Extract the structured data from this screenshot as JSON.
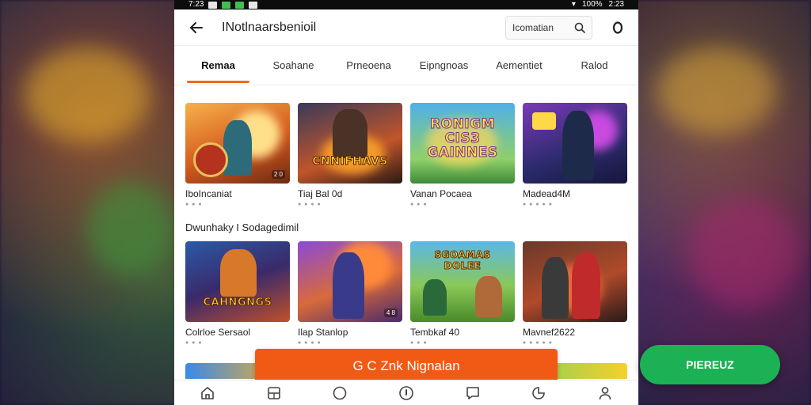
{
  "status": {
    "time": "7:23",
    "battery": "100%",
    "clock": "2:23"
  },
  "appbar": {
    "title": "INotlnaarsbenioil",
    "search_label": "Icomatian"
  },
  "tabs": [
    {
      "label": "Remaa",
      "active": true
    },
    {
      "label": "Soahane",
      "active": false
    },
    {
      "label": "Prneoena",
      "active": false
    },
    {
      "label": "Eipngnoas",
      "active": false
    },
    {
      "label": "Aementiet",
      "active": false
    },
    {
      "label": "Ralod",
      "active": false
    }
  ],
  "row1": [
    {
      "title": "IboIncaniat",
      "logo": "",
      "tag": "2 0"
    },
    {
      "title": "Tiaj Bal 0d",
      "logo": "CNNIFHAVS",
      "tag": ""
    },
    {
      "title": "Vanan Pocaea",
      "logo": "RONIGM CIS3 GAINNES",
      "tag": ""
    },
    {
      "title": "Madead4M",
      "logo": "",
      "tag": ""
    }
  ],
  "section": {
    "title": "Dwunhaky I Sodagedimil"
  },
  "row2": [
    {
      "title": "Colrloe Sersaol",
      "logo": "CAHNGNGS",
      "tag": ""
    },
    {
      "title": "Ilap Stanlop",
      "logo": "",
      "tag": "4 8"
    },
    {
      "title": "Tembkaf 40",
      "logo": "SGOAMAS DOLEE",
      "tag": ""
    },
    {
      "title": "Mavnef2622",
      "logo": "",
      "tag": ""
    }
  ],
  "cta": {
    "label": "G C Znk Nignalan"
  },
  "side_button": {
    "label": "PIEREUZ"
  },
  "colors": {
    "accent": "#f15a15",
    "tab_indicator": "#f26a1b",
    "side_button": "#1db155"
  }
}
